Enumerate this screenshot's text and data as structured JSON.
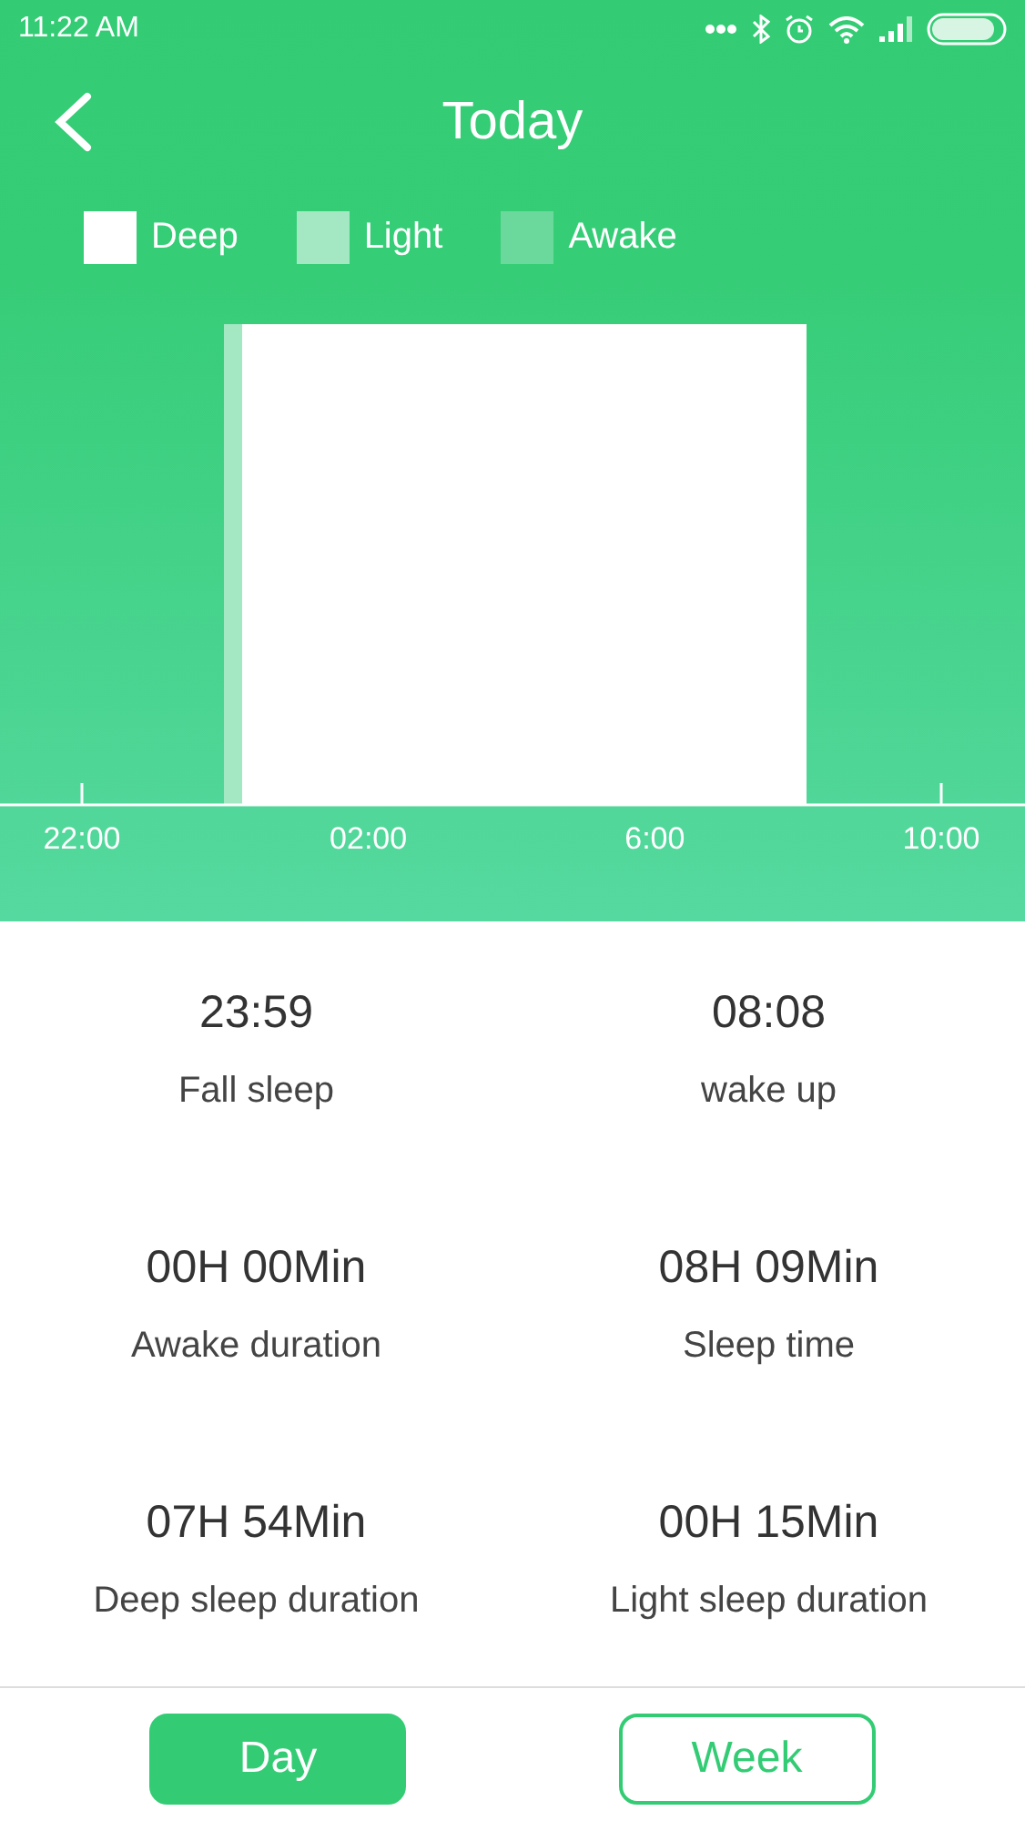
{
  "status_bar": {
    "time": "11:22  AM"
  },
  "header": {
    "title": "Today"
  },
  "legend": [
    {
      "label": "Deep",
      "color": "#ffffff"
    },
    {
      "label": "Light",
      "color": "#a3e8c3"
    },
    {
      "label": "Awake",
      "color": "#6cd99c"
    }
  ],
  "sleep_chart": {
    "axis_labels": [
      "22:00",
      "02:00",
      "6:00",
      "10:00"
    ]
  },
  "stats": [
    {
      "value": "23:59",
      "label": "Fall sleep"
    },
    {
      "value": "08:08",
      "label": "wake up"
    },
    {
      "value": "00H 00Min",
      "label": "Awake duration"
    },
    {
      "value": "08H 09Min",
      "label": "Sleep time"
    },
    {
      "value": "07H 54Min",
      "label": "Deep sleep duration"
    },
    {
      "value": "00H 15Min",
      "label": "Light sleep duration"
    }
  ],
  "tabs": [
    {
      "label": "Day",
      "selected": true
    },
    {
      "label": "Week",
      "selected": false
    }
  ]
}
